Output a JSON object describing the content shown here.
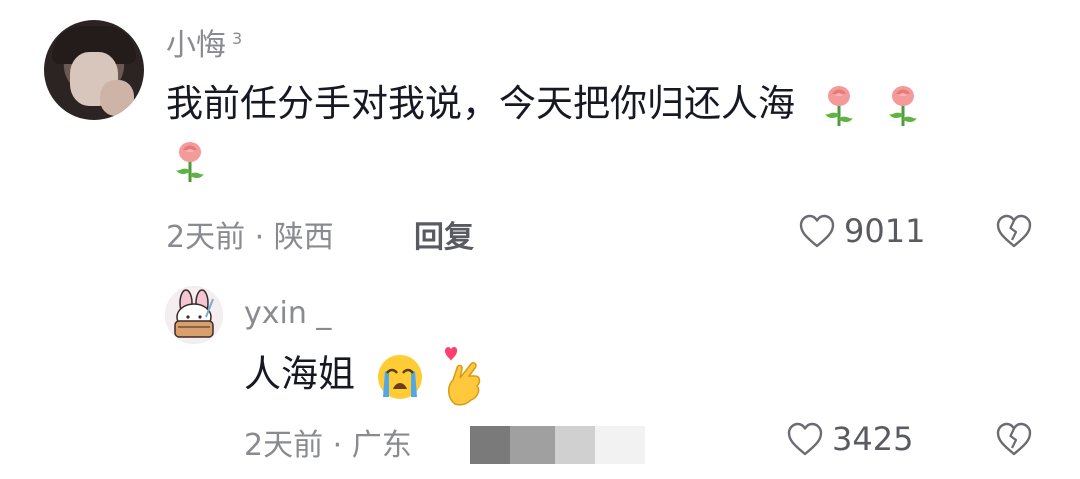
{
  "comment": {
    "username": "小悔",
    "user_sup": "3",
    "text": "我前任分手对我说，今天把你归还人海",
    "time_location": "2天前 · 陕西",
    "reply_label": "回复",
    "likes": "9011"
  },
  "reply": {
    "username": "yxin _",
    "text": "人海姐",
    "time_location": "2天前 · 广东",
    "likes": "3425"
  },
  "colors": {
    "meta_gray": "#8a8b91",
    "icon_gray": "#5a5b62",
    "text_dark": "#161823"
  }
}
